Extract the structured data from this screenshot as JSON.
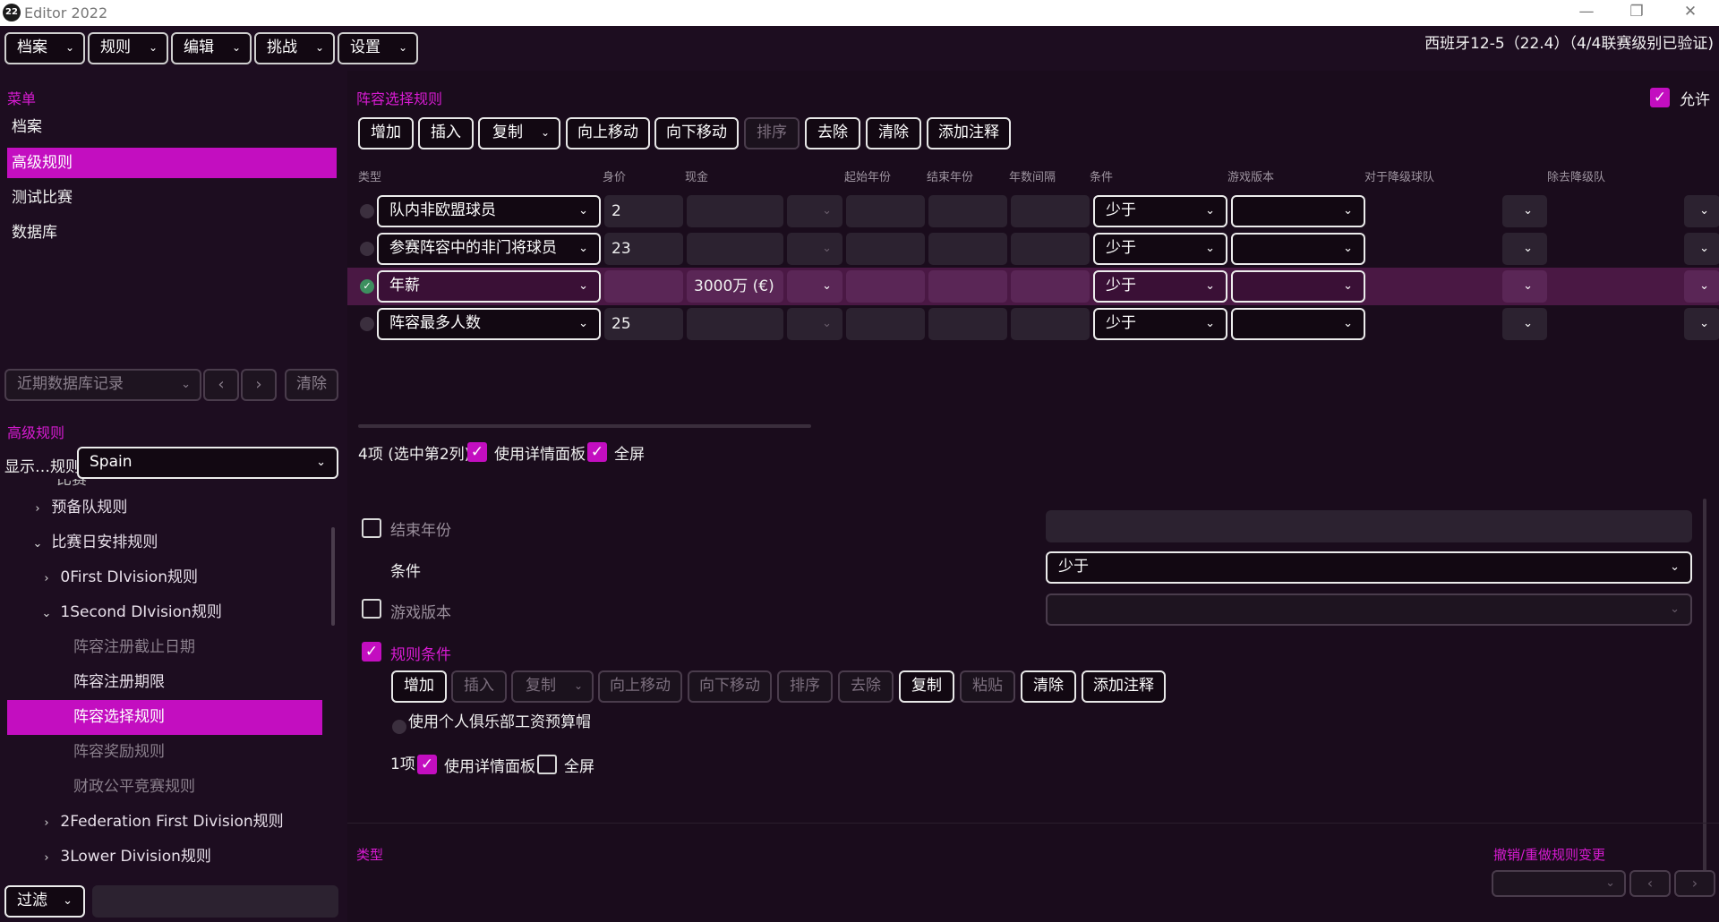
{
  "app": {
    "logo": "22",
    "title": "Editor 2022",
    "status": "西班牙12-5（22.4）（4/4联赛级别已验证)"
  },
  "menubar": [
    "档案",
    "规则",
    "编辑",
    "挑战",
    "设置"
  ],
  "left": {
    "menu_label": "菜单",
    "menu_items": [
      "档案",
      "高级规则",
      "测试比赛",
      "数据库"
    ],
    "recent_placeholder": "近期数据库记录",
    "clear": "清除",
    "adv_label": "高级规则",
    "show_rules_label": "显示…规则",
    "show_rules_value": "Spain",
    "tree_partial": "比赛",
    "tree": [
      {
        "label": "预备队规则",
        "arrow": "›"
      },
      {
        "label": "比赛日安排规则",
        "arrow": "⌄"
      },
      {
        "label": "0First DIvision规则",
        "arrow": "›"
      },
      {
        "label": "1Second DIvision规则",
        "arrow": "⌄"
      },
      {
        "label": "阵容注册截止日期",
        "arrow": ""
      },
      {
        "label": "阵容注册期限",
        "arrow": ""
      },
      {
        "label": "阵容选择规则",
        "arrow": ""
      },
      {
        "label": "阵容奖励规则",
        "arrow": ""
      },
      {
        "label": "财政公平竞赛规则",
        "arrow": ""
      },
      {
        "label": "2Federation First Division规则",
        "arrow": "›"
      },
      {
        "label": "3Lower Division规则",
        "arrow": "›"
      }
    ],
    "filter": "过滤"
  },
  "main": {
    "section_title": "阵容选择规则",
    "allow_label": "允许",
    "toolbar": [
      "增加",
      "插入",
      "复制",
      "向上移动",
      "向下移动",
      "排序",
      "去除",
      "清除",
      "添加注释"
    ],
    "columns": [
      "类型",
      "身价",
      "现金",
      "起始年份",
      "结束年份",
      "年数间隔",
      "条件",
      "游戏版本",
      "对于降级球队",
      "除去降级队"
    ],
    "rows": [
      {
        "type": "队内非欧盟球员",
        "value": "2",
        "cash": "",
        "cond": "少于"
      },
      {
        "type": "参赛阵容中的非门将球员",
        "value": "23",
        "cash": "",
        "cond": "少于"
      },
      {
        "type": "年薪",
        "value": "",
        "cash": "3000万 (€)",
        "cond": "少于"
      },
      {
        "type": "阵容最多人数",
        "value": "25",
        "cash": "",
        "cond": "少于"
      }
    ],
    "count_text": "4项 (选中第2列)",
    "use_detail": "使用详情面板",
    "fullscreen": "全屏",
    "detail": {
      "end_year": "结束年份",
      "condition": "条件",
      "condition_value": "少于",
      "game_version": "游戏版本",
      "rule_condition": "规则条件"
    },
    "toolbar2": [
      "增加",
      "插入",
      "复制",
      "向上移动",
      "向下移动",
      "排序",
      "去除",
      "复制",
      "粘贴",
      "清除",
      "添加注释"
    ],
    "sub_item": "使用个人俱乐部工资预算帽",
    "count2": "1项",
    "use_detail2": "使用详情面板",
    "fullscreen2": "全屏",
    "bottom_type": "类型",
    "undo_label": "撤销/重做规则变更"
  },
  "icons": [
    "chevron-down-icon",
    "check-icon",
    "chevron-left-icon",
    "chevron-right-icon",
    "chevron-right-tree-icon",
    "minimize-icon",
    "restore-icon",
    "close-icon"
  ],
  "colors": {
    "accent": "#c30ec0",
    "accent_text": "#d81bd2",
    "bg": "#1a0c1c",
    "selected_row": "#4a1844"
  }
}
